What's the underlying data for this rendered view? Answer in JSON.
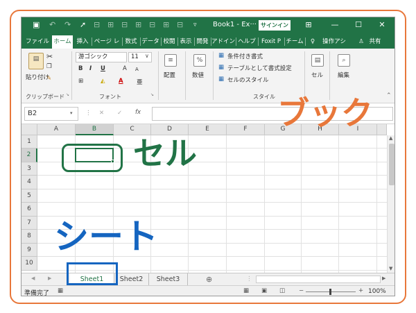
{
  "colors": {
    "accent_green": "#217346",
    "annotation_orange": "#e8773a",
    "annotation_blue": "#1565c0",
    "frame_border": "#e8773a"
  },
  "titlebar": {
    "save_icon": "save-icon",
    "title": "Book1 - Ex···",
    "signin": "サインイン",
    "minimize": "—",
    "maximize": "☐",
    "close": "✕"
  },
  "tabs": [
    "ファイル",
    "ホーム",
    "挿入",
    "ページ レ",
    "数式",
    "データ",
    "校閲",
    "表示",
    "開発",
    "アドイン",
    "ヘルプ",
    "Foxit P",
    "チーム",
    "操作アシ",
    "共有"
  ],
  "ribbon": {
    "paste": "貼り付け",
    "clipboard": "クリップボード",
    "font_name": "游ゴシック",
    "font_size": "11",
    "bold": "B",
    "italic": "I",
    "underline": "U",
    "grow": "A",
    "shrink": "A",
    "font_group": "フォント",
    "align": "配置",
    "number": "数値",
    "percent": "%",
    "cond_format": "条件付き書式",
    "table_format": "テーブルとして書式設定",
    "cell_style": "セルのスタイル",
    "style_group": "スタイル",
    "cells": "セル",
    "editing": "編集"
  },
  "formula_bar": {
    "namebox": "B2",
    "cancel": "✕",
    "enter": "✓",
    "fx": "fx",
    "value": ""
  },
  "grid": {
    "columns": [
      "A",
      "B",
      "C",
      "D",
      "E",
      "F",
      "G",
      "H",
      "I"
    ],
    "rows": [
      "1",
      "2",
      "3",
      "4",
      "5",
      "6",
      "7",
      "8",
      "9",
      "10"
    ],
    "active_cell": "B2"
  },
  "sheets": [
    "Sheet1",
    "Sheet2",
    "Sheet3"
  ],
  "status": {
    "ready": "準備完了",
    "zoom": "100%",
    "minus": "−",
    "plus": "+"
  },
  "annotations": {
    "book": "ブック",
    "cell": "セル",
    "sheet": "シート"
  }
}
